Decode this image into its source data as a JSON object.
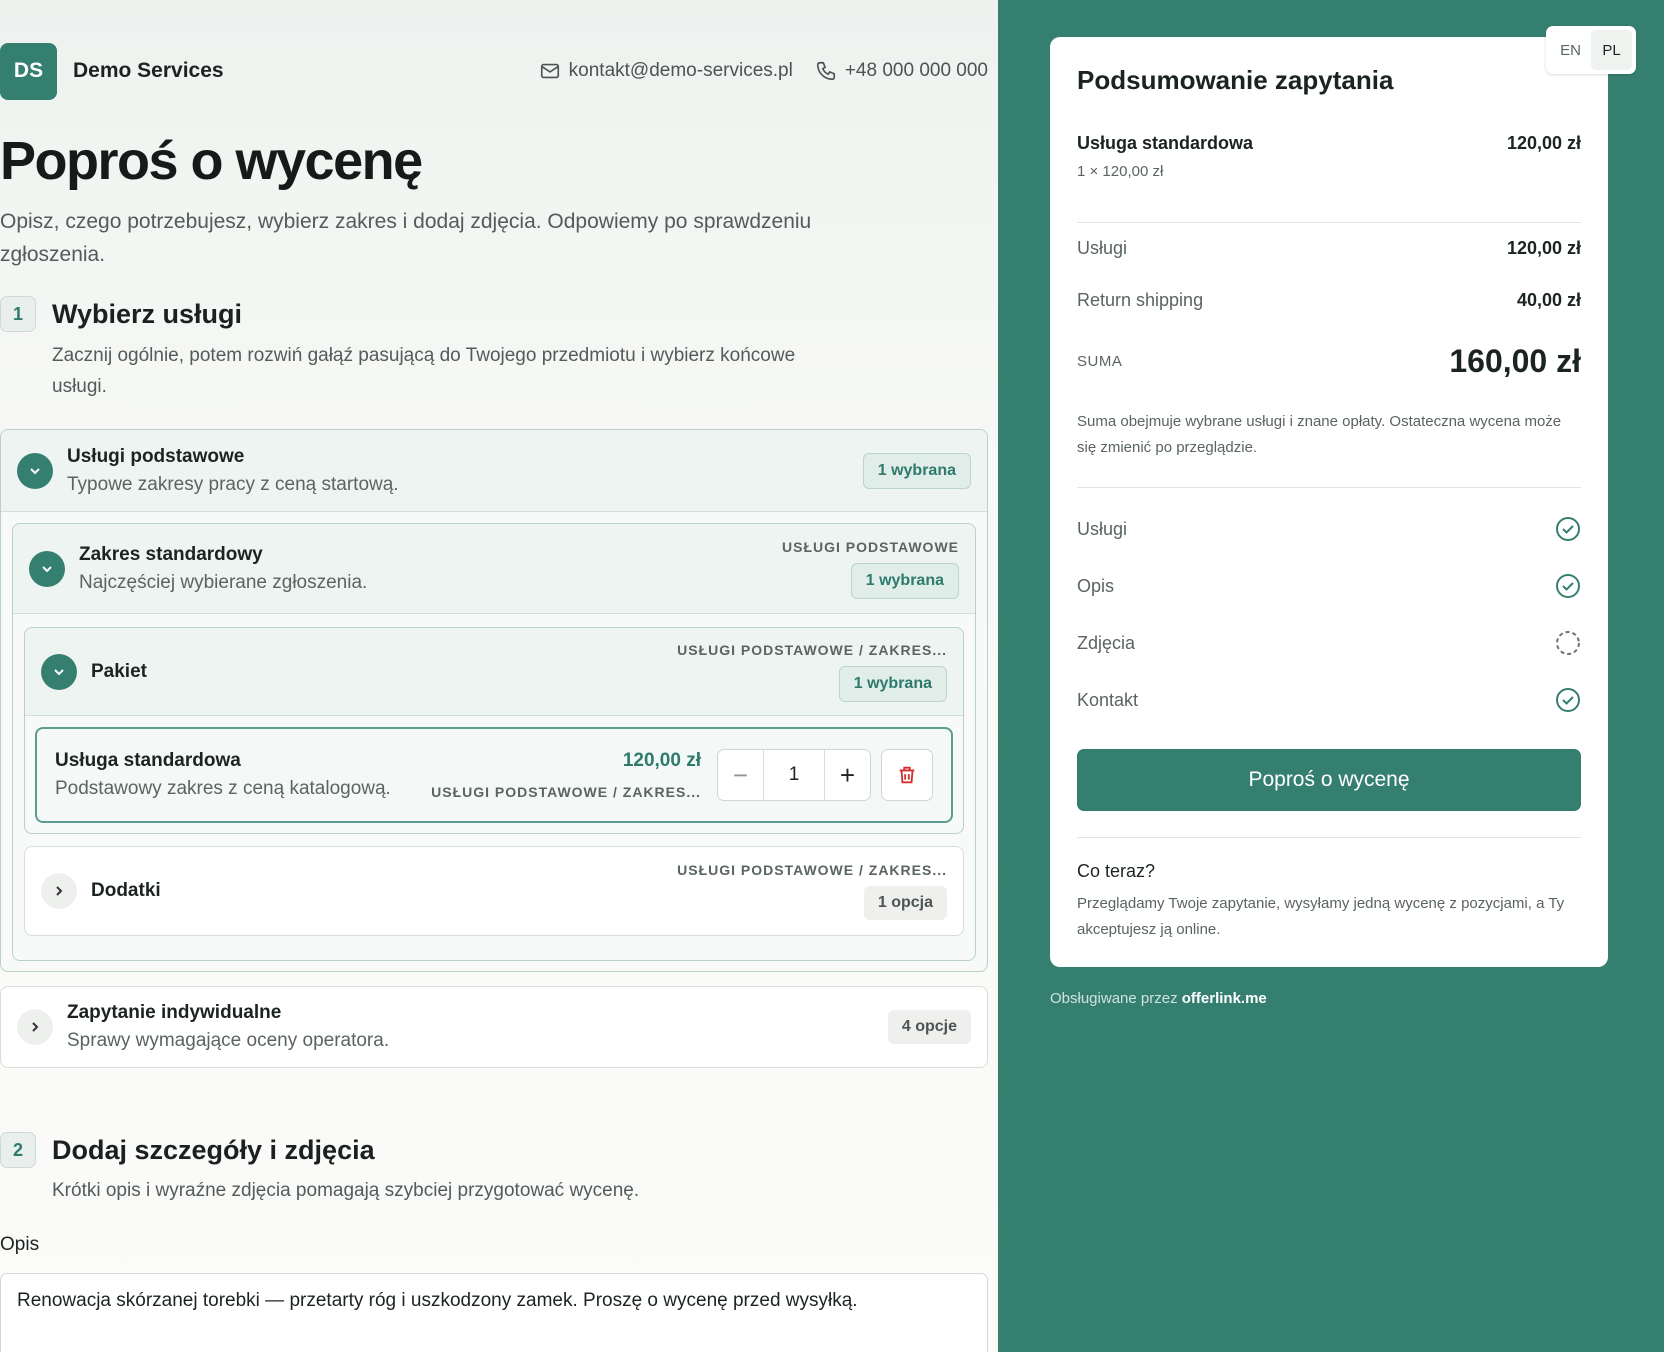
{
  "header": {
    "logo": "DS",
    "brand": "Demo Services",
    "email": "kontakt@demo-services.pl",
    "phone": "+48 000 000 000"
  },
  "page": {
    "title": "Poproś o wycenę",
    "lead": "Opisz, czego potrzebujesz, wybierz zakres i dodaj zdjęcia. Odpowiemy po sprawdzeniu zgłoszenia."
  },
  "step1": {
    "num": "1",
    "title": "Wybierz usługi",
    "desc": "Zacznij ogólnie, potem rozwiń gałąź pasującą do Twojego przedmiotu i wybierz końcowe usługi."
  },
  "tree": {
    "basic": {
      "title": "Usługi podstawowe",
      "sub": "Typowe zakresy pracy z ceną startową.",
      "badge": "1 wybrana"
    },
    "standard": {
      "title": "Zakres standardowy",
      "sub": "Najczęściej wybierane zgłoszenia.",
      "crumb": "USŁUGI PODSTAWOWE",
      "badge": "1 wybrana"
    },
    "package": {
      "title": "Pakiet",
      "crumb": "USŁUGI PODSTAWOWE / ZAKRES...",
      "badge": "1 wybrana"
    },
    "item": {
      "title": "Usługa standardowa",
      "sub": "Podstawowy zakres z ceną katalogową.",
      "price": "120,00 zł",
      "crumb": "USŁUGI PODSTAWOWE / ZAKRES...",
      "qty": "1",
      "minus": "−",
      "plus": "+"
    },
    "addons": {
      "title": "Dodatki",
      "crumb": "USŁUGI PODSTAWOWE / ZAKRES...",
      "badge": "1 opcja"
    },
    "custom": {
      "title": "Zapytanie indywidualne",
      "sub": "Sprawy wymagające oceny operatora.",
      "badge": "4 opcje"
    }
  },
  "step2": {
    "num": "2",
    "title": "Dodaj szczegóły i zdjęcia",
    "desc": "Krótki opis i wyraźne zdjęcia pomagają szybciej przygotować wycenę.",
    "field_label": "Opis",
    "field_value": "Renowacja skórzanej torebki — przetarty róg i uszkodzony zamek. Proszę o wycenę przed wysyłką."
  },
  "lang": {
    "en": "EN",
    "pl": "PL",
    "active": "PL"
  },
  "summary": {
    "title": "Podsumowanie zapytania",
    "line_name": "Usługa standardowa",
    "line_detail": "1 × 120,00 zł",
    "line_price": "120,00 zł",
    "services_label": "Usługi",
    "services_value": "120,00 zł",
    "shipping_label": "Return shipping",
    "shipping_value": "40,00 zł",
    "total_label": "SUMA",
    "total_value": "160,00 zł",
    "note": "Suma obejmuje wybrane usługi i znane opłaty. Ostateczna wycena może się zmienić po przeglądzie.",
    "checklist": [
      {
        "label": "Usługi",
        "status": "done"
      },
      {
        "label": "Opis",
        "status": "done"
      },
      {
        "label": "Zdjęcia",
        "status": "pending"
      },
      {
        "label": "Kontakt",
        "status": "done"
      }
    ],
    "cta": "Poproś o wycenę",
    "next_title": "Co teraz?",
    "next_text": "Przeglądamy Twoje zapytanie, wysyłamy jedną wycenę z pozycjami, a Ty akceptujesz ją online."
  },
  "footer": {
    "prefix": "Obsługiwane przez",
    "brand": "offerlink.me"
  },
  "colors": {
    "accent": "#357f71",
    "danger": "#d32f2f"
  }
}
